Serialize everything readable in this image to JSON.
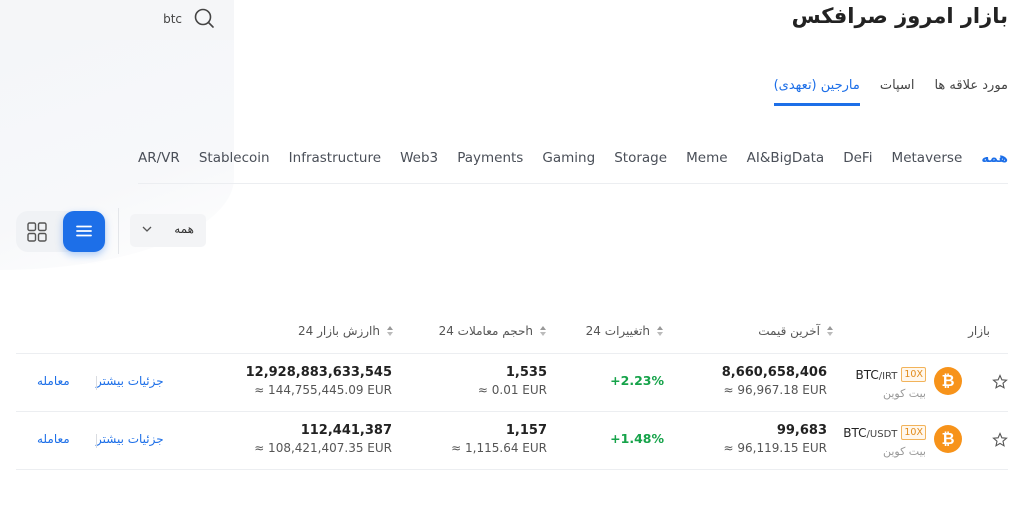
{
  "search": {
    "value": "btc"
  },
  "page_title": "بازار امروز صرافکس",
  "tabs": [
    {
      "label": "مورد علاقه ها"
    },
    {
      "label": "اسپات"
    },
    {
      "label": "مارجین (تعهدی)",
      "active": true
    }
  ],
  "categories": [
    {
      "label": "همه",
      "active": true
    },
    {
      "label": "Metaverse"
    },
    {
      "label": "DeFi"
    },
    {
      "label": "AI&BigData"
    },
    {
      "label": "Meme"
    },
    {
      "label": "Storage"
    },
    {
      "label": "Gaming"
    },
    {
      "label": "Payments"
    },
    {
      "label": "Web3"
    },
    {
      "label": "Infrastructure"
    },
    {
      "label": "Stablecoin"
    },
    {
      "label": "AR/VR"
    }
  ],
  "filter": {
    "selected": "همه"
  },
  "table": {
    "headers": {
      "market": "بازار",
      "last_price": "آخرین قیمت",
      "change": "تغییرات 24h",
      "volume": "حجم معاملات 24h",
      "market_cap": "ارزش بازار 24h"
    },
    "rows": [
      {
        "base": "BTC",
        "quote": "/IRT",
        "leverage": "10X",
        "name": "بیت کوین",
        "price": "8,660,658,406",
        "price_sub": "≈ 96,967.18 EUR",
        "change": "+2.23%",
        "volume": "1,535",
        "volume_sub": "≈ 0.01 EUR",
        "cap": "12,928,883,633,545",
        "cap_sub": "≈ 144,755,445.09 EUR",
        "details": "جزئیات بیشتر",
        "trade": "معامله"
      },
      {
        "base": "BTC",
        "quote": "/USDT",
        "leverage": "10X",
        "name": "بیت کوین",
        "price": "99,683",
        "price_sub": "≈ 96,119.15 EUR",
        "change": "+1.48%",
        "volume": "1,157",
        "volume_sub": "≈ 1,115.64 EUR",
        "cap": "112,441,387",
        "cap_sub": "≈ 108,421,407.35 EUR",
        "details": "جزئیات بیشتر",
        "trade": "معامله"
      }
    ]
  },
  "colors": {
    "accent": "#1d6fe8",
    "positive": "#16a34a",
    "btc": "#f7931a",
    "leverage": "#e28b1b"
  }
}
